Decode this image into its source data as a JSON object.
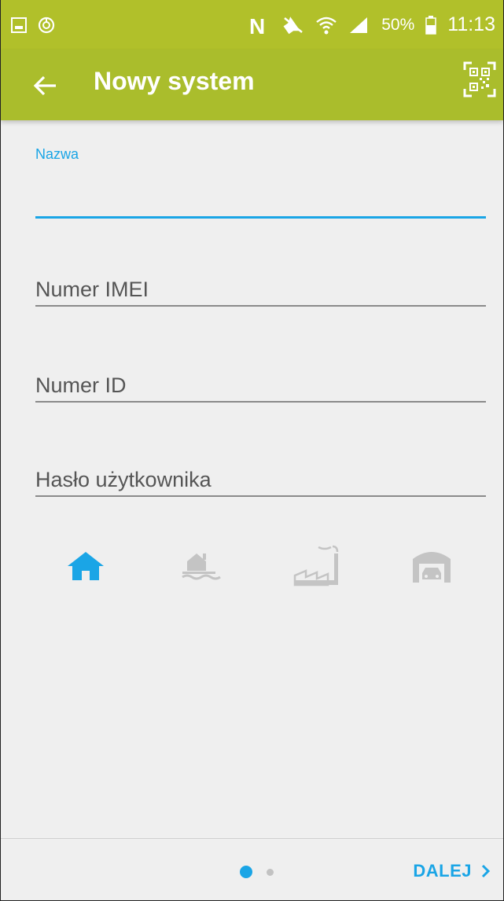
{
  "status_bar": {
    "battery_percent": "50%",
    "time": "11:13",
    "icons": [
      "gallery-icon",
      "sync-icon",
      "nfc-icon",
      "mute-icon",
      "wifi-icon",
      "signal-icon",
      "battery-icon"
    ]
  },
  "app_bar": {
    "title": "Nowy system",
    "back_icon": "arrow-left-icon",
    "action_icon": "qr-code-scan-icon",
    "color": "#aabd2c"
  },
  "form": {
    "name": {
      "label": "Nazwa",
      "value": ""
    },
    "imei": {
      "placeholder": "Numer IMEI",
      "value": ""
    },
    "id": {
      "placeholder": "Numer ID",
      "value": ""
    },
    "password": {
      "placeholder": "Hasło użytkownika",
      "value": ""
    }
  },
  "system_types": [
    {
      "icon": "house-icon",
      "selected": true
    },
    {
      "icon": "house-by-water-icon",
      "selected": false
    },
    {
      "icon": "factory-icon",
      "selected": false
    },
    {
      "icon": "garage-icon",
      "selected": false
    }
  ],
  "pagination": {
    "current": 1,
    "total": 2
  },
  "footer": {
    "next_label": "DALEJ",
    "next_icon": "chevron-right-icon"
  },
  "colors": {
    "accent": "#1aa5e6",
    "inactive_icon": "#c4c4c4",
    "background": "#efefef"
  }
}
